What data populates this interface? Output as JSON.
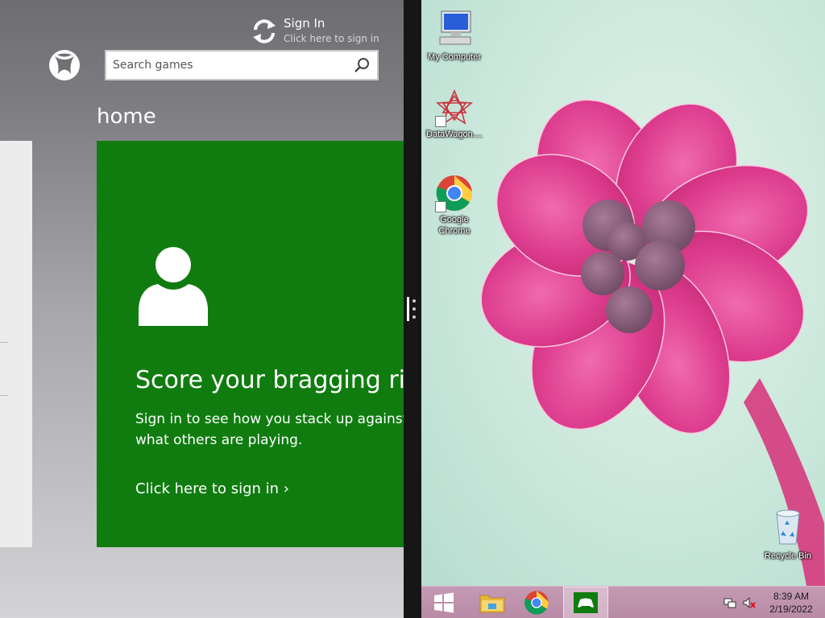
{
  "games_app": {
    "sign_in": {
      "title": "Sign In",
      "subtitle": "Click here to sign in"
    },
    "search": {
      "placeholder": "Search games"
    },
    "section_title": "home",
    "tile": {
      "headline": "Score your bragging rig",
      "body_line1": "Sign in to see how you stack up against",
      "body_line2": "what others are playing.",
      "link": "Click here to sign in ›",
      "color": "#107c10"
    }
  },
  "desktop": {
    "icons": [
      {
        "label": "My Computer",
        "icon": "computer-icon"
      },
      {
        "label": "DataWagon....",
        "icon": "datawagon-icon"
      },
      {
        "label": "Google Chrome",
        "icon": "chrome-icon"
      },
      {
        "label": "Recycle Bin",
        "icon": "recycle-bin-icon"
      }
    ]
  },
  "taskbar": {
    "items": [
      "windows-start-icon",
      "file-explorer-icon",
      "chrome-icon",
      "xbox-games-icon"
    ],
    "clock": {
      "time": "8:39 AM",
      "date": "2/19/2022"
    }
  }
}
